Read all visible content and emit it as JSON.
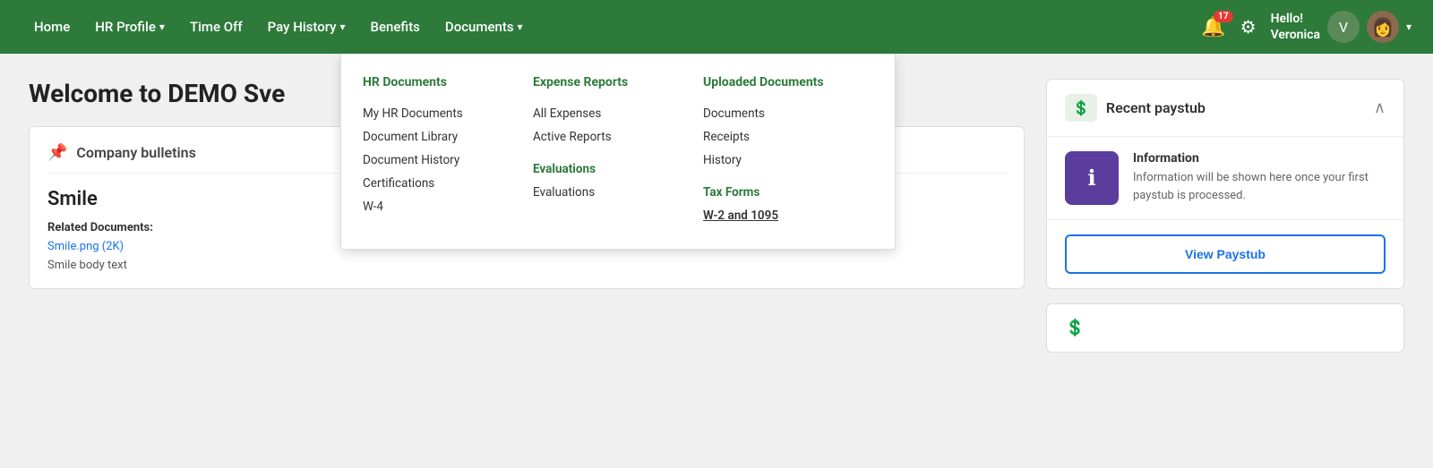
{
  "nav": {
    "brand": "",
    "items": [
      {
        "id": "home",
        "label": "Home",
        "hasDropdown": false
      },
      {
        "id": "hr-profile",
        "label": "HR Profile",
        "hasDropdown": true
      },
      {
        "id": "time-off",
        "label": "Time Off",
        "hasDropdown": false
      },
      {
        "id": "pay-history",
        "label": "Pay History",
        "hasDropdown": true
      },
      {
        "id": "benefits",
        "label": "Benefits",
        "hasDropdown": false
      },
      {
        "id": "documents",
        "label": "Documents",
        "hasDropdown": true
      }
    ],
    "bell_badge": "17",
    "user_greeting": "Hello!",
    "user_name": "Veronica"
  },
  "dropdown": {
    "col1": {
      "header": "HR Documents",
      "items": [
        "My HR Documents",
        "Document Library",
        "Document History",
        "Certifications",
        "W-4"
      ]
    },
    "col2": {
      "header": "Expense Reports",
      "items": [
        "All Expenses",
        "Active Reports"
      ],
      "sub_header": "Evaluations",
      "sub_items": [
        "Evaluations"
      ]
    },
    "col3": {
      "header": "Uploaded Documents",
      "items": [
        "Documents",
        "Receipts",
        "History"
      ],
      "sub_header": "Tax Forms",
      "sub_items": [
        "W-2 and 1095"
      ]
    }
  },
  "main": {
    "page_title": "Welcome to DEMO Sve",
    "company_bulletins": {
      "header": "Company bulletins",
      "bulletin_title": "Smile",
      "related_docs_label": "Related Documents:",
      "doc_link": "Smile.png (2K)",
      "doc_body_text": "Smile body text"
    }
  },
  "paystub": {
    "title": "Recent paystub",
    "info_title": "Information",
    "info_body": "Information will be shown here once your first paystub is processed.",
    "view_button": "View Paystub"
  },
  "icons": {
    "bell": "🔔",
    "gear": "⚙",
    "pin": "📌",
    "paystub": "💲",
    "info": "ℹ",
    "chevron_up": "∧",
    "chevron_down": "∨",
    "second_card": "💲"
  }
}
